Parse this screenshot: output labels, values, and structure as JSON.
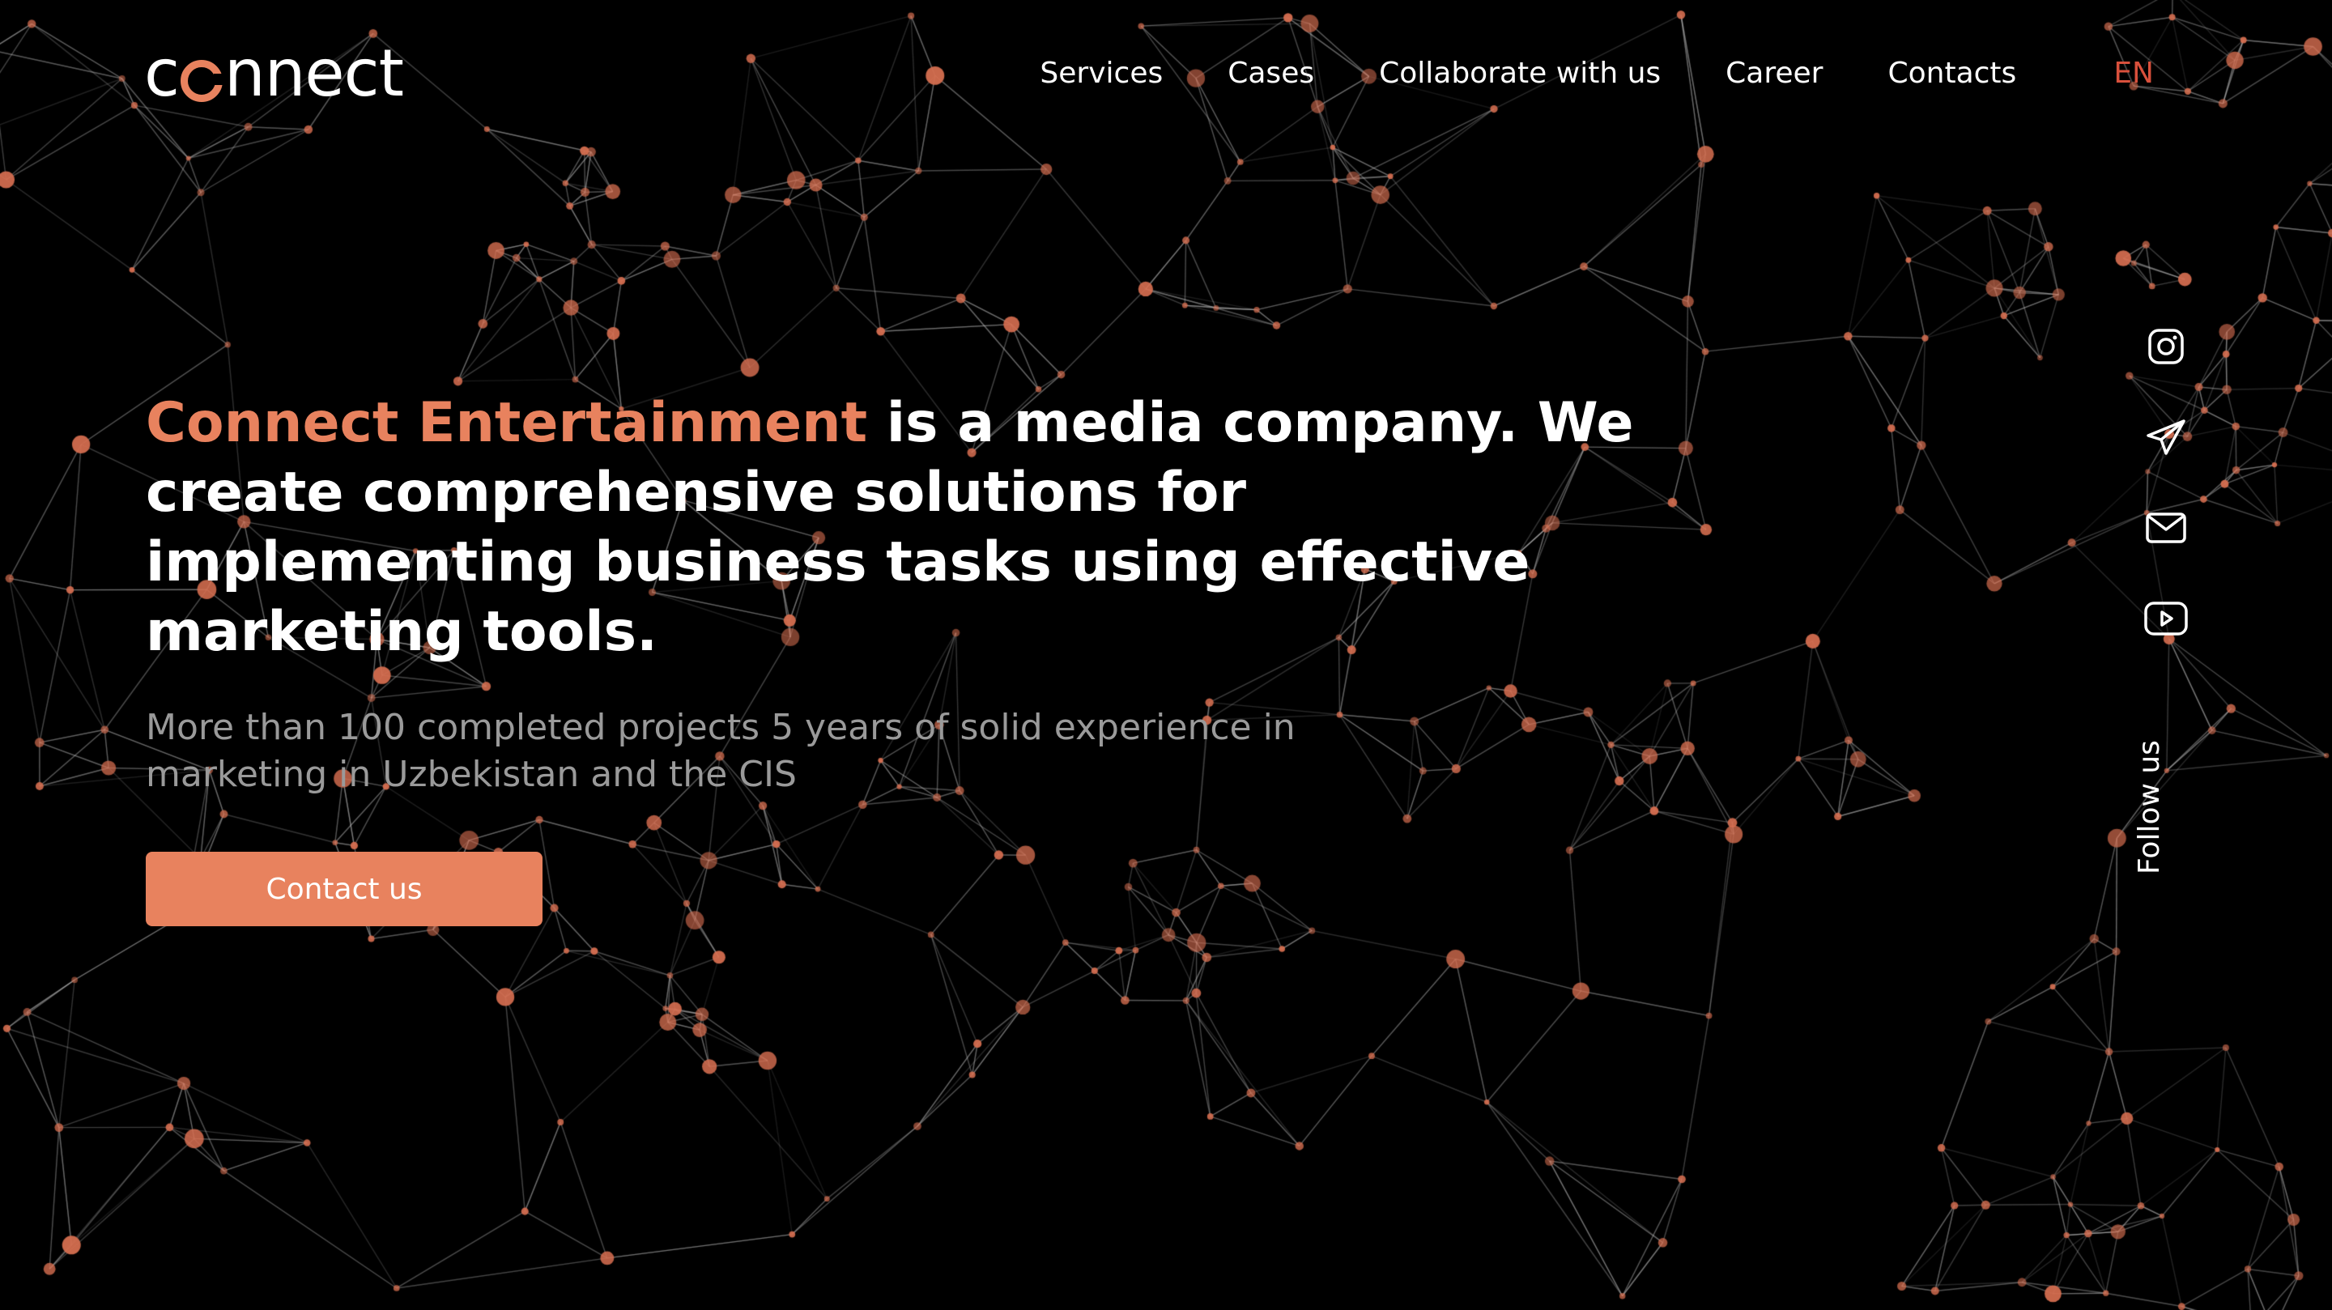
{
  "brand": {
    "logo_before": "c",
    "logo_after": "nnect",
    "accent_color": "#e8825e",
    "lang_color": "#d9503c"
  },
  "nav": {
    "items": [
      {
        "label": "Services"
      },
      {
        "label": "Cases"
      },
      {
        "label": "Collaborate with us"
      },
      {
        "label": "Career"
      },
      {
        "label": "Contacts"
      }
    ],
    "language": "EN"
  },
  "hero": {
    "title_accent": "Connect Entertainment",
    "title_rest": " is a media company. We create comprehensive solutions for implementing business tasks using effective marketing tools.",
    "subtitle": "More than 100 completed projects 5 years of solid experience in marketing in Uzbekistan and the CIS",
    "cta_label": "Contact us"
  },
  "social": {
    "icons": [
      "instagram-icon",
      "telegram-icon",
      "mail-icon",
      "youtube-icon"
    ],
    "follow_label": "Follow us"
  }
}
